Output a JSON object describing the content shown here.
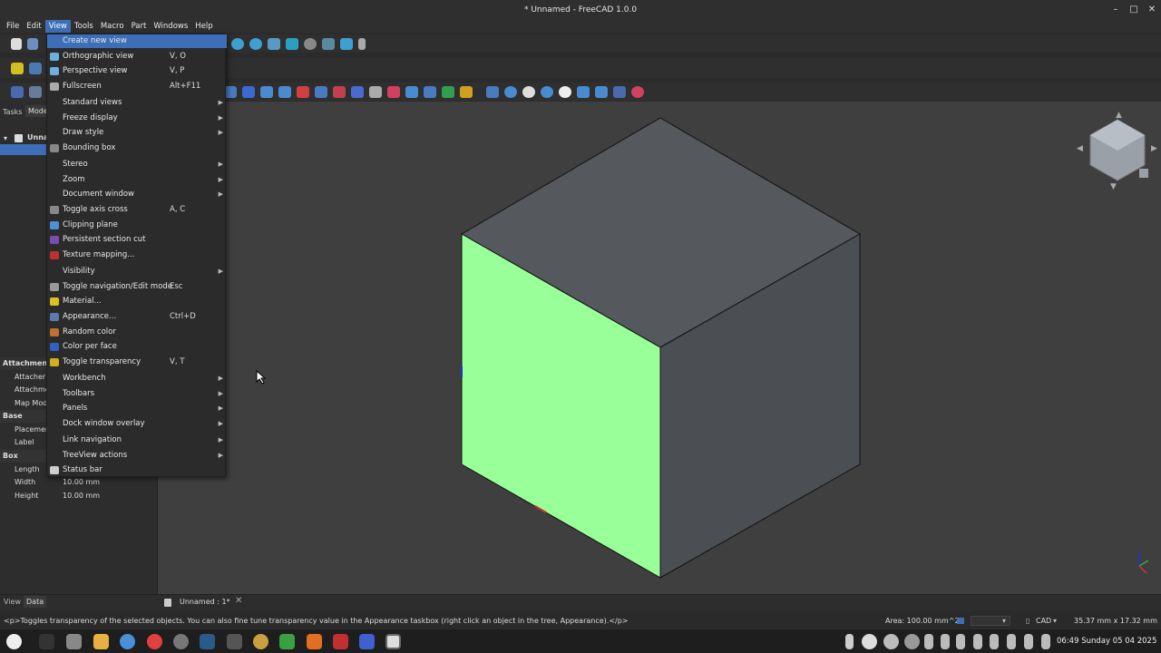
{
  "window": {
    "title": "* Unnamed - FreeCAD 1.0.0",
    "minimize": "–",
    "maximize": "□",
    "close": "✕"
  },
  "menubar": [
    "File",
    "Edit",
    "View",
    "Tools",
    "Macro",
    "Part",
    "Windows",
    "Help"
  ],
  "view_menu": [
    {
      "label": "Create new view",
      "shortcut": "",
      "submenu": false,
      "icon": "new-view-icon",
      "color": "#3d6fb8"
    },
    {
      "label": "Orthographic view",
      "shortcut": "V, O",
      "submenu": false,
      "icon": "orthographic-icon",
      "color": "#6ab0e0"
    },
    {
      "label": "Perspective view",
      "shortcut": "V, P",
      "submenu": false,
      "icon": "perspective-icon",
      "color": "#6ab0e0"
    },
    {
      "label": "Fullscreen",
      "shortcut": "Alt+F11",
      "submenu": false,
      "icon": "fullscreen-icon",
      "color": "#aaaaaa"
    },
    {
      "label": "Standard views",
      "shortcut": "",
      "submenu": true
    },
    {
      "label": "Freeze display",
      "shortcut": "",
      "submenu": true
    },
    {
      "label": "Draw style",
      "shortcut": "",
      "submenu": true
    },
    {
      "label": "Bounding box",
      "shortcut": "",
      "submenu": false,
      "icon": "bounding-box-icon",
      "color": "#888888"
    },
    {
      "label": "Stereo",
      "shortcut": "",
      "submenu": true
    },
    {
      "label": "Zoom",
      "shortcut": "",
      "submenu": true
    },
    {
      "label": "Document window",
      "shortcut": "",
      "submenu": true
    },
    {
      "label": "Toggle axis cross",
      "shortcut": "A, C",
      "submenu": false,
      "icon": "checkmark-icon",
      "color": "#888888"
    },
    {
      "label": "Clipping plane",
      "shortcut": "",
      "submenu": false,
      "icon": "clipping-plane-icon",
      "color": "#4a90d9"
    },
    {
      "label": "Persistent section cut",
      "shortcut": "",
      "submenu": false,
      "icon": "section-cut-icon",
      "color": "#7a4bb0"
    },
    {
      "label": "Texture mapping...",
      "shortcut": "",
      "submenu": false,
      "icon": "texture-icon",
      "color": "#c03030"
    },
    {
      "label": "Visibility",
      "shortcut": "",
      "submenu": true
    },
    {
      "label": "Toggle navigation/Edit mode",
      "shortcut": "Esc",
      "submenu": false,
      "icon": "navigation-icon",
      "color": "#999999"
    },
    {
      "label": "Material...",
      "shortcut": "",
      "submenu": false,
      "icon": "material-icon",
      "color": "#e0c020"
    },
    {
      "label": "Appearance...",
      "shortcut": "Ctrl+D",
      "submenu": false,
      "icon": "appearance-icon",
      "color": "#5a7ab0"
    },
    {
      "label": "Random color",
      "shortcut": "",
      "submenu": false,
      "icon": "random-color-icon",
      "color": "#c07030"
    },
    {
      "label": "Color per face",
      "shortcut": "",
      "submenu": false,
      "icon": "color-per-face-icon",
      "color": "#3060c0"
    },
    {
      "label": "Toggle transparency",
      "shortcut": "V, T",
      "submenu": false,
      "icon": "transparency-icon",
      "color": "#d0b020"
    },
    {
      "label": "Workbench",
      "shortcut": "",
      "submenu": true
    },
    {
      "label": "Toolbars",
      "shortcut": "",
      "submenu": true
    },
    {
      "label": "Panels",
      "shortcut": "",
      "submenu": true
    },
    {
      "label": "Dock window overlay",
      "shortcut": "",
      "submenu": true
    },
    {
      "label": "Link navigation",
      "shortcut": "",
      "submenu": true
    },
    {
      "label": "TreeView actions",
      "shortcut": "",
      "submenu": true
    },
    {
      "label": "Status bar",
      "shortcut": "",
      "submenu": false,
      "icon": "checkbox-icon",
      "color": "#cccccc"
    }
  ],
  "left_panel": {
    "tab_tasks": "Tasks",
    "tab_model": "Mode",
    "tree_item": "Unna",
    "properties": [
      {
        "name": "Attachment",
        "value": "",
        "section": true
      },
      {
        "name": "Attacher",
        "value": "",
        "section": false
      },
      {
        "name": "Attachme",
        "value": "",
        "section": false
      },
      {
        "name": "Map Mod",
        "value": "",
        "section": false
      },
      {
        "name": "Base",
        "value": "",
        "section": true
      },
      {
        "name": "Placemer",
        "value": "",
        "section": false
      },
      {
        "name": "Label",
        "value": "",
        "section": false
      },
      {
        "name": "Box",
        "value": "",
        "section": true
      },
      {
        "name": "Length",
        "value": "",
        "section": false
      },
      {
        "name": "Width",
        "value": "10.00 mm",
        "section": false
      },
      {
        "name": "Height",
        "value": "10.00 mm",
        "section": false
      }
    ]
  },
  "bottom_tabs": {
    "view": "View",
    "data": "Data",
    "doc_tab": "Unnamed : 1*"
  },
  "statusbar": {
    "message": "<p>Toggles transparency of the selected objects. You can also fine tune transparency value in the Appearance taskbox (right click an object in the tree, Appearance).</p>",
    "area": "Area: 100.00 mm^2",
    "nav_style": "CAD",
    "dimensions": "35.37 mm x 17.32 mm"
  },
  "taskbar": {
    "clock": "06:49 Sunday 05 04 2025"
  },
  "colors": {
    "menu_highlight": "#3d6fb8",
    "selected_face": "#99ff99",
    "cube_gray": "#53565a",
    "viewport_bg": "#3f3f3f"
  }
}
